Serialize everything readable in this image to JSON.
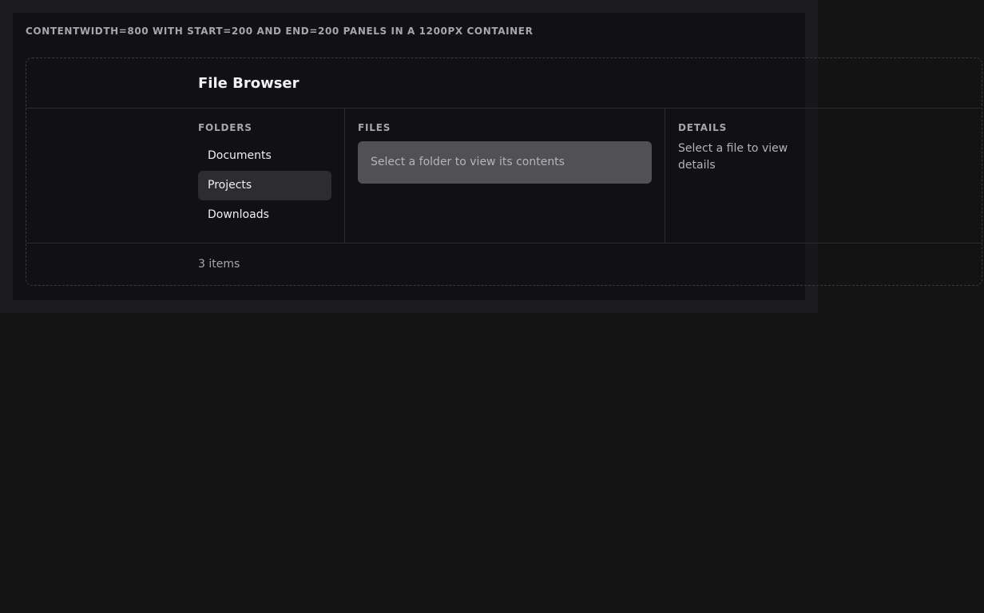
{
  "caption": "CONTENTWIDTH=800 WITH START=200 AND END=200 PANELS IN A 1200PX CONTAINER",
  "header": {
    "title": "File Browser"
  },
  "folders": {
    "label": "FOLDERS",
    "items": [
      {
        "label": "Documents",
        "selected": false
      },
      {
        "label": "Projects",
        "selected": true
      },
      {
        "label": "Downloads",
        "selected": false
      }
    ]
  },
  "files": {
    "label": "FILES",
    "empty_message": "Select a folder to view its contents"
  },
  "details": {
    "label": "DETAILS",
    "empty_message": "Select a file to view details"
  },
  "footer": {
    "status": "3 items"
  },
  "colors": {
    "page_bg": "#141414",
    "panel_bg": "#111115",
    "selected_bg": "#2c2c31",
    "placeholder_bg": "#505055"
  }
}
